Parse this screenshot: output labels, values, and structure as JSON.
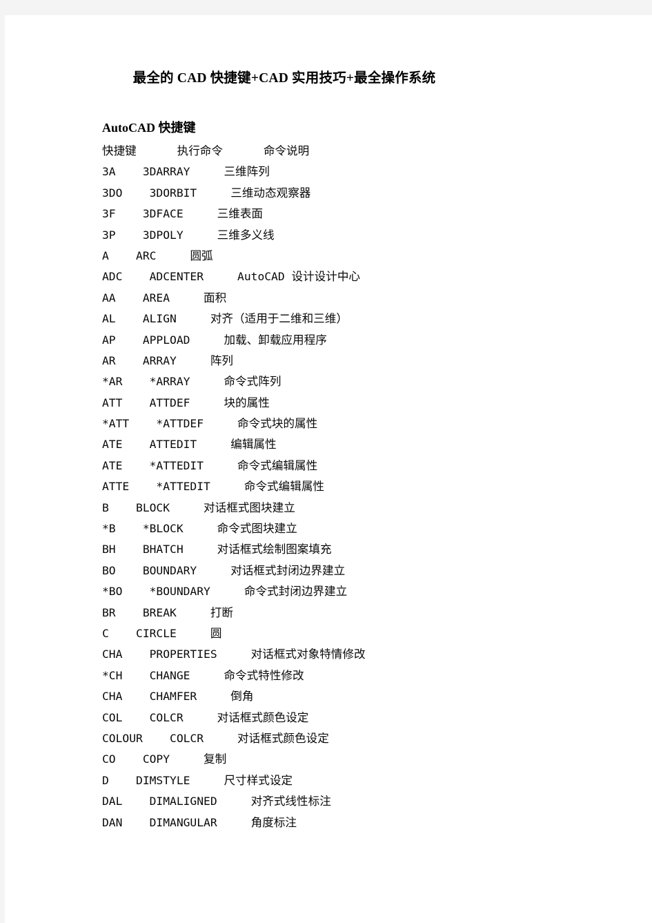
{
  "document": {
    "title": "最全的 CAD 快捷键+CAD 实用技巧+最全操作系统",
    "section_heading": "AutoCAD 快捷键",
    "page_background": "#ffffff",
    "canvas_background": "#f4f4f4",
    "text_color": "#0a0a0a",
    "table": {
      "columns": [
        "快捷键",
        "执行命令",
        "命令说明"
      ],
      "header_line": "快捷键      执行命令      命令说明",
      "rows": [
        {
          "line": "3A    3DARRAY     三维阵列",
          "shortcut": "3A",
          "command": "3DARRAY",
          "description": "三维阵列"
        },
        {
          "line": "3DO    3DORBIT     三维动态观察器",
          "shortcut": "3DO",
          "command": "3DORBIT",
          "description": "三维动态观察器"
        },
        {
          "line": "3F    3DFACE     三维表面",
          "shortcut": "3F",
          "command": "3DFACE",
          "description": "三维表面"
        },
        {
          "line": "3P    3DPOLY     三维多义线",
          "shortcut": "3P",
          "command": "3DPOLY",
          "description": "三维多义线"
        },
        {
          "line": "A    ARC     圆弧",
          "shortcut": "A",
          "command": "ARC",
          "description": "圆弧"
        },
        {
          "line": "ADC    ADCENTER     AutoCAD 设计设计中心",
          "shortcut": "ADC",
          "command": "ADCENTER",
          "description": "AutoCAD 设计设计中心"
        },
        {
          "line": "AA    AREA     面积",
          "shortcut": "AA",
          "command": "AREA",
          "description": "面积"
        },
        {
          "line": "AL    ALIGN     对齐（适用于二维和三维）",
          "shortcut": "AL",
          "command": "ALIGN",
          "description": "对齐（适用于二维和三维）"
        },
        {
          "line": "AP    APPLOAD     加载、卸载应用程序",
          "shortcut": "AP",
          "command": "APPLOAD",
          "description": "加载、卸载应用程序"
        },
        {
          "line": "AR    ARRAY     阵列",
          "shortcut": "AR",
          "command": "ARRAY",
          "description": "阵列"
        },
        {
          "line": "*AR    *ARRAY     命令式阵列",
          "shortcut": "*AR",
          "command": "*ARRAY",
          "description": "命令式阵列"
        },
        {
          "line": "ATT    ATTDEF     块的属性",
          "shortcut": "ATT",
          "command": "ATTDEF",
          "description": "块的属性"
        },
        {
          "line": "*ATT    *ATTDEF     命令式块的属性",
          "shortcut": "*ATT",
          "command": "*ATTDEF",
          "description": "命令式块的属性"
        },
        {
          "line": "ATE    ATTEDIT     编辑属性",
          "shortcut": "ATE",
          "command": "ATTEDIT",
          "description": "编辑属性"
        },
        {
          "line": "ATE    *ATTEDIT     命令式编辑属性",
          "shortcut": "ATE",
          "command": "*ATTEDIT",
          "description": "命令式编辑属性"
        },
        {
          "line": "ATTE    *ATTEDIT     命令式编辑属性",
          "shortcut": "ATTE",
          "command": "*ATTEDIT",
          "description": "命令式编辑属性"
        },
        {
          "line": "B    BLOCK     对话框式图块建立",
          "shortcut": "B",
          "command": "BLOCK",
          "description": "对话框式图块建立"
        },
        {
          "line": "*B    *BLOCK     命令式图块建立",
          "shortcut": "*B",
          "command": "*BLOCK",
          "description": "命令式图块建立"
        },
        {
          "line": "BH    BHATCH     对话框式绘制图案填充",
          "shortcut": "BH",
          "command": "BHATCH",
          "description": "对话框式绘制图案填充"
        },
        {
          "line": "BO    BOUNDARY     对话框式封闭边界建立",
          "shortcut": "BO",
          "command": "BOUNDARY",
          "description": "对话框式封闭边界建立"
        },
        {
          "line": "*BO    *BOUNDARY     命令式封闭边界建立",
          "shortcut": "*BO",
          "command": "*BOUNDARY",
          "description": "命令式封闭边界建立"
        },
        {
          "line": "BR    BREAK     打断",
          "shortcut": "BR",
          "command": "BREAK",
          "description": "打断"
        },
        {
          "line": "C    CIRCLE     圆",
          "shortcut": "C",
          "command": "CIRCLE",
          "description": "圆"
        },
        {
          "line": "CHA    PROPERTIES     对话框式对象特情修改",
          "shortcut": "CHA",
          "command": "PROPERTIES",
          "description": "对话框式对象特情修改"
        },
        {
          "line": "*CH    CHANGE     命令式特性修改",
          "shortcut": "*CH",
          "command": "CHANGE",
          "description": "命令式特性修改"
        },
        {
          "line": "CHA    CHAMFER     倒角",
          "shortcut": "CHA",
          "command": "CHAMFER",
          "description": "倒角"
        },
        {
          "line": "COL    COLCR     对话框式颜色设定",
          "shortcut": "COL",
          "command": "COLCR",
          "description": "对话框式颜色设定"
        },
        {
          "line": "COLOUR    COLCR     对话框式颜色设定",
          "shortcut": "COLOUR",
          "command": "COLCR",
          "description": "对话框式颜色设定"
        },
        {
          "line": "CO    COPY     复制",
          "shortcut": "CO",
          "command": "COPY",
          "description": "复制"
        },
        {
          "line": "D    DIMSTYLE     尺寸样式设定",
          "shortcut": "D",
          "command": "DIMSTYLE",
          "description": "尺寸样式设定"
        },
        {
          "line": "DAL    DIMALIGNED     对齐式线性标注",
          "shortcut": "DAL",
          "command": "DIMALIGNED",
          "description": "对齐式线性标注"
        },
        {
          "line": "DAN    DIMANGULAR     角度标注",
          "shortcut": "DAN",
          "command": "DIMANGULAR",
          "description": "角度标注"
        }
      ]
    }
  }
}
